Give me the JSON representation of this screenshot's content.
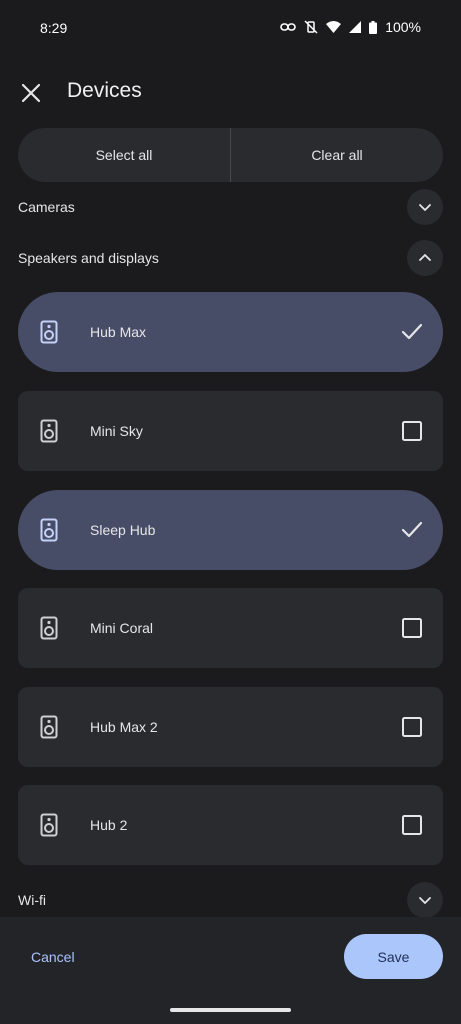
{
  "status": {
    "time": "8:29",
    "battery": "100%"
  },
  "header": {
    "title": "Devices"
  },
  "actions": {
    "select_all": "Select all",
    "clear_all": "Clear all"
  },
  "sections": {
    "cameras": "Cameras",
    "speakers": "Speakers and displays",
    "wifi": "Wi-fi"
  },
  "devices": [
    {
      "label": "Hub Max",
      "selected": true
    },
    {
      "label": "Mini Sky",
      "selected": false
    },
    {
      "label": "Sleep Hub",
      "selected": true
    },
    {
      "label": "Mini Coral",
      "selected": false
    },
    {
      "label": "Hub Max 2",
      "selected": false
    },
    {
      "label": "Hub 2",
      "selected": false
    }
  ],
  "footer": {
    "cancel": "Cancel",
    "save": "Save"
  },
  "colors": {
    "background": "#1b1b1d",
    "card": "#2a2b2f",
    "card_selected": "#474d66",
    "accent": "#aac6fb"
  }
}
